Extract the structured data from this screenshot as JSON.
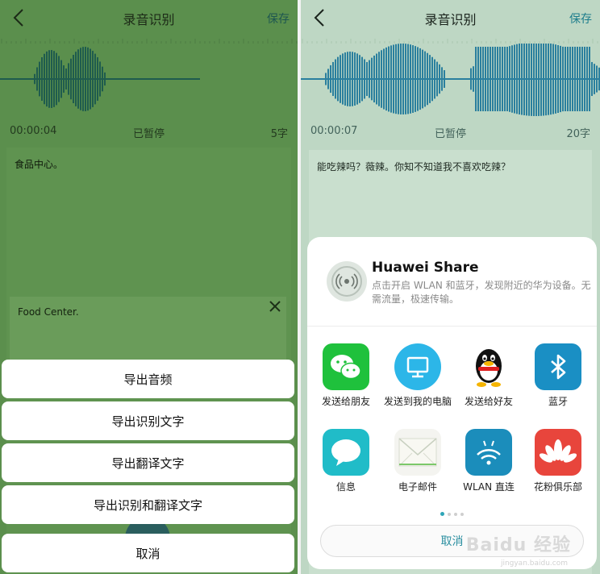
{
  "left": {
    "header": {
      "title": "录音识别",
      "save_label": "保存"
    },
    "info": {
      "time": "00:00:04",
      "status": "已暂停",
      "count": "5字"
    },
    "recognized_text": "食品中心。",
    "translated_text": "Food Center.",
    "export_menu": [
      "导出音频",
      "导出识别文字",
      "导出翻译文字",
      "导出识别和翻译文字"
    ],
    "cancel_label": "取消",
    "colors": {
      "background": "#5b8f4d",
      "wave": "#1f5c4e"
    }
  },
  "right": {
    "header": {
      "title": "录音识别",
      "save_label": "保存"
    },
    "info": {
      "time": "00:00:07",
      "status": "已暂停",
      "count": "20字"
    },
    "recognized_text": "能吃辣吗？薇辣。你知不知道我不喜欢吃辣？",
    "share": {
      "title": "Huawei Share",
      "description": "点击开启 WLAN 和蓝牙，发现附近的华为设备。无需流量，极速传输。",
      "icon": "wireless-signal-icon",
      "apps": [
        {
          "label": "发送给朋友",
          "icon": "wechat-icon"
        },
        {
          "label": "发送到我的电脑",
          "icon": "computer-icon"
        },
        {
          "label": "发送给好友",
          "icon": "qq-penguin-icon"
        },
        {
          "label": "蓝牙",
          "icon": "bluetooth-icon"
        },
        {
          "label": "信息",
          "icon": "message-icon"
        },
        {
          "label": "电子邮件",
          "icon": "email-icon"
        },
        {
          "label": "WLAN 直连",
          "icon": "wlan-direct-icon"
        },
        {
          "label": "花粉俱乐部",
          "icon": "huawei-club-icon"
        }
      ],
      "page_count": 4,
      "active_page": 1,
      "cancel_label": "取消"
    },
    "watermark": "Baidu 经验",
    "watermark_sub": "jingyan.baidu.com",
    "colors": {
      "background": "#bed7c4",
      "wave": "#2a7f9e",
      "accent": "#2fa6b8"
    }
  }
}
